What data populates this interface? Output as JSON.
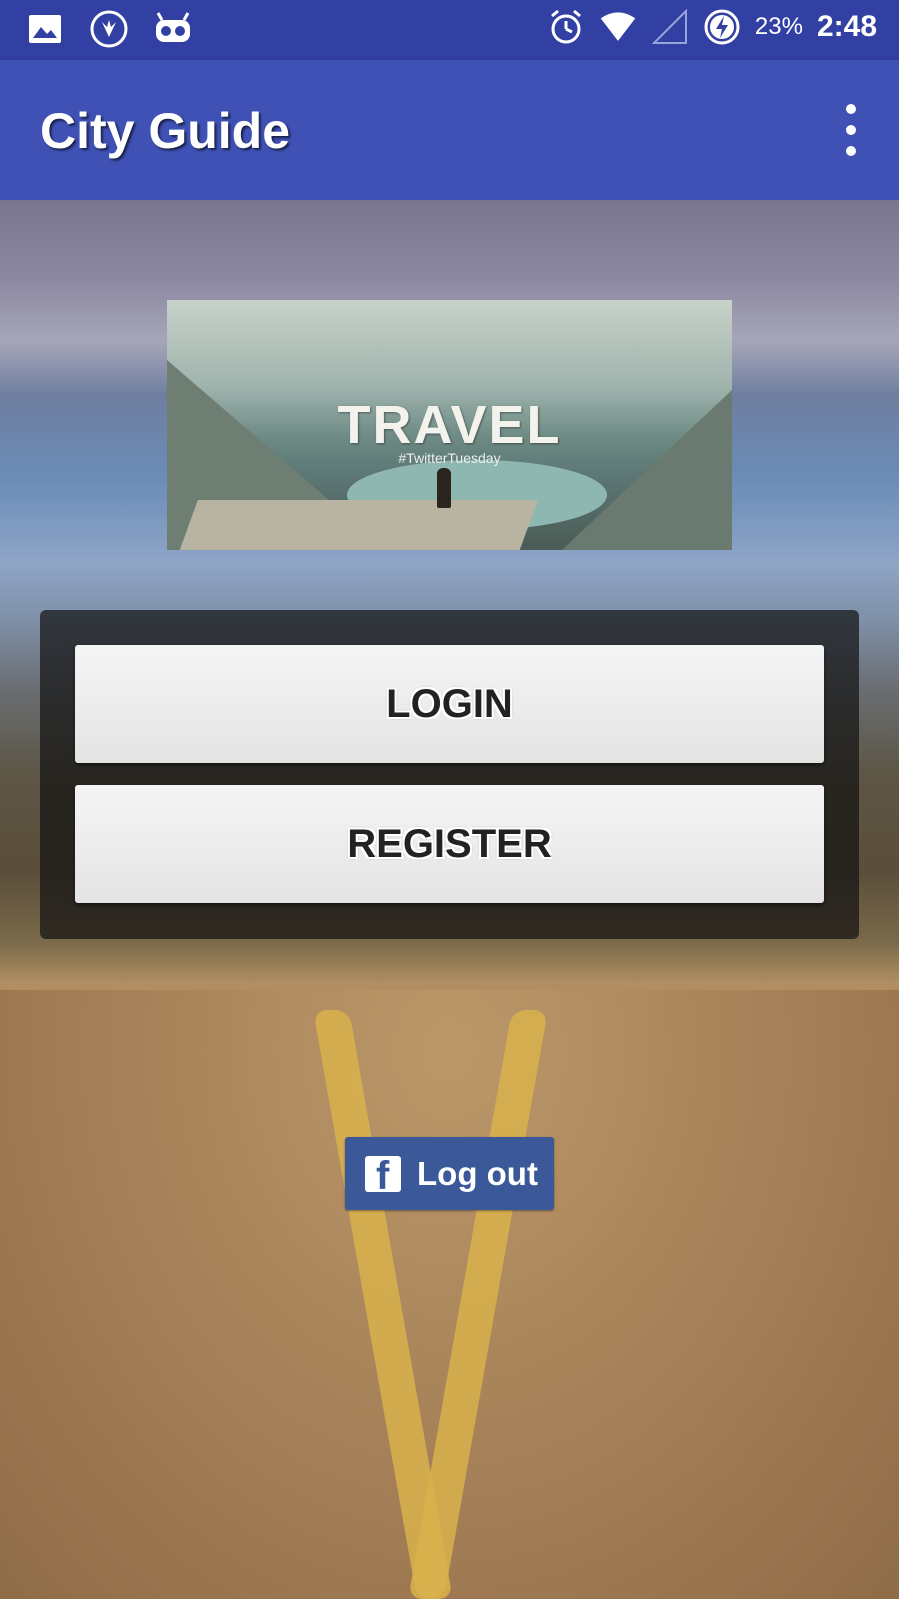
{
  "status_bar": {
    "battery_percent": "23%",
    "time": "2:48",
    "left_icons": [
      "gallery-icon",
      "app-icon",
      "robot-icon"
    ],
    "right_icons": [
      "alarm-icon",
      "wifi-icon",
      "signal-icon",
      "battery-charging-icon"
    ]
  },
  "app_bar": {
    "title": "City Guide",
    "overflow_icon": "more-vert-icon"
  },
  "banner": {
    "title": "TRAVEL",
    "hashtag": "#TwitterTuesday"
  },
  "panel": {
    "login_label": "LOGIN",
    "register_label": "REGISTER"
  },
  "facebook": {
    "logout_label": "Log out",
    "brand_color": "#3b5998"
  },
  "colors": {
    "status_bar": "#3340a3",
    "app_bar": "#3f51b5"
  }
}
